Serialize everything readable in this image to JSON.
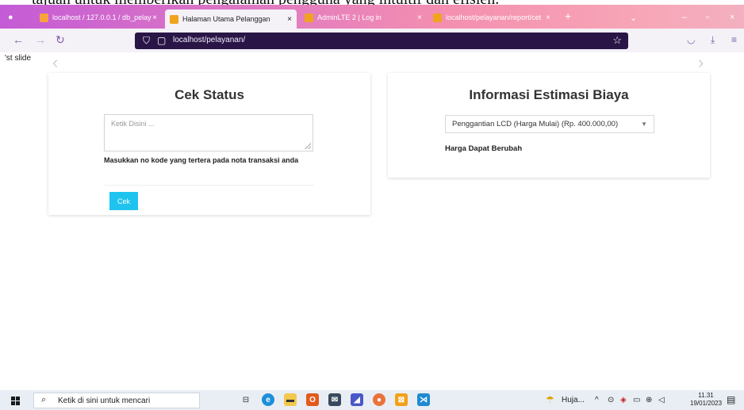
{
  "doc_text": "tajuan untuk memberikan pengalaman pengguna yang intuitif dan efisien.",
  "tabs": [
    {
      "label": "localhost / 127.0.0.1 / db_pelay",
      "favicon_color": "#f7a23b",
      "active": false
    },
    {
      "label": "Halaman Utama Pelanggan",
      "favicon_color": "#f0a31d",
      "active": true
    },
    {
      "label": "AdminLTE 2 | Log in",
      "favicon_color": "#f0a31d",
      "active": false
    },
    {
      "label": "localhost/pelayanan/report/cet",
      "favicon_color": "#f0a31d",
      "active": false
    }
  ],
  "url": "localhost/pelayanan/",
  "slide_text": "'st slide",
  "cek_status": {
    "title": "Cek Status",
    "placeholder": "Ketik Disini ...",
    "help": "Masukkan no kode yang tertera pada nota transaksi anda",
    "button": "Cek",
    "button_color": "#1ec4ee"
  },
  "estimasi": {
    "title": "Informasi Estimasi Biaya",
    "selected": "Penggantian LCD (Harga Mulai) (Rp. 400.000,00)",
    "note": "Harga Dapat Berubah"
  },
  "taskbar": {
    "search_placeholder": "Ketik di sini untuk mencari",
    "weather": "Huja...",
    "time": "11.31",
    "date": "19/01/2023"
  }
}
